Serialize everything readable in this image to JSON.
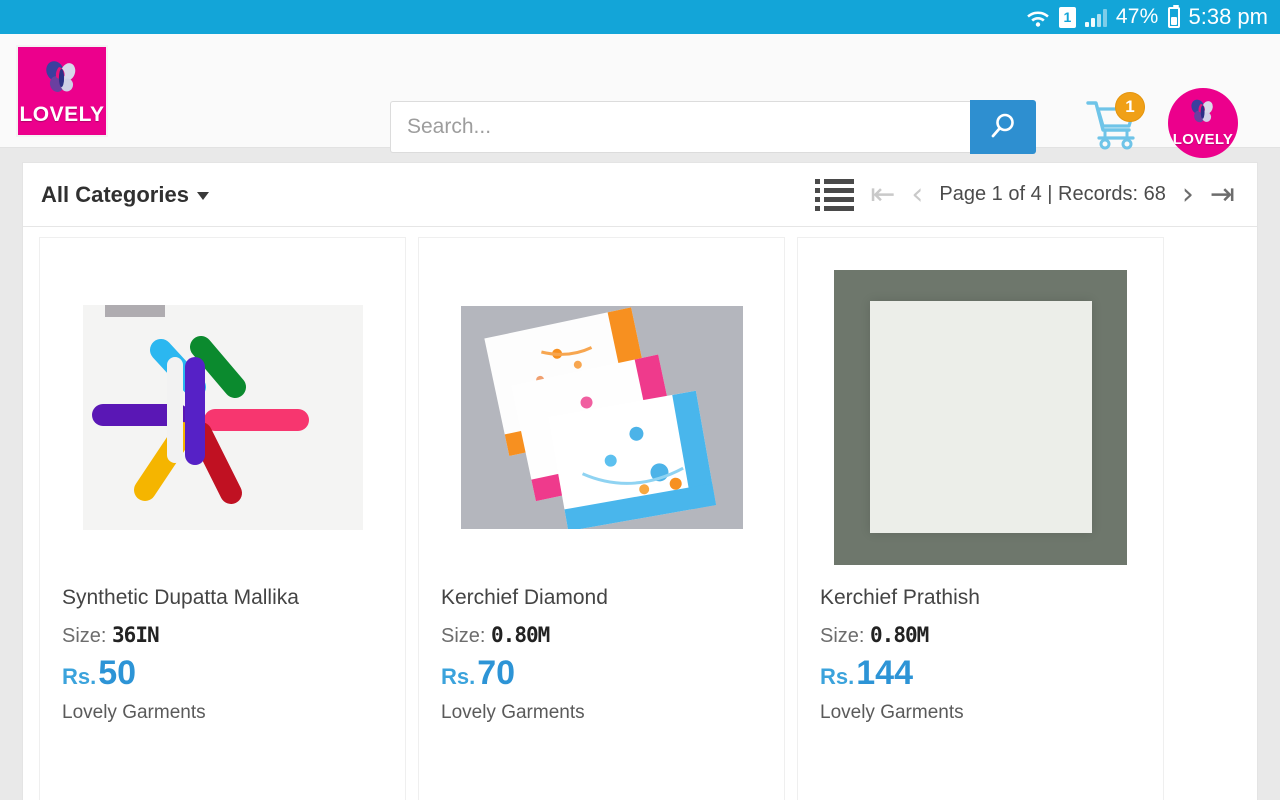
{
  "statusbar": {
    "wifi_icon": "wifi-icon",
    "sim_label": "1",
    "signal_icon": "signal-bars-icon",
    "battery_percent": "47%",
    "battery_icon": "battery-icon",
    "time": "5:38 pm"
  },
  "header": {
    "logo_text": "LOVELY",
    "logo_icon": "butterfly-icon",
    "search": {
      "placeholder": "Search...",
      "value": "",
      "button_icon": "search-icon"
    },
    "cart": {
      "icon": "shopping-cart-icon",
      "badge_count": "1"
    },
    "avatar": {
      "icon": "user-avatar-icon",
      "label": "LOVELY"
    }
  },
  "toolbar": {
    "categories_label": "All Categories",
    "categories_caret": "chevron-down-icon",
    "view_toggle_icon": "list-view-icon",
    "first_page_icon": "first-page-icon",
    "prev_page_icon": "prev-page-icon",
    "pager_text": "Page 1 of 4 | Records: 68",
    "next_page_icon": "next-page-icon",
    "last_page_icon": "last-page-icon",
    "page_current": 1,
    "page_total": 4,
    "records": 68
  },
  "products": [
    {
      "name": "Synthetic Dupatta Mallika",
      "size_label": "Size:",
      "size_value": "36IN",
      "currency": "Rs.",
      "price": "50",
      "brand": "Lovely Garments",
      "image_alt": "colorful-rolled-dupattas"
    },
    {
      "name": "Kerchief Diamond",
      "size_label": "Size:",
      "size_value": "0.80M",
      "currency": "Rs.",
      "price": "70",
      "brand": "Lovely Garments",
      "image_alt": "floral-handkerchiefs-trio"
    },
    {
      "name": "Kerchief Prathish",
      "size_label": "Size:",
      "size_value": "0.80M",
      "currency": "Rs.",
      "price": "144",
      "brand": "Lovely Garments",
      "image_alt": "white-folded-handkerchief"
    }
  ],
  "colors": {
    "status_bar": "#13A5D8",
    "brand_pink": "#EC008C",
    "accent_blue": "#2D94D6",
    "search_button": "#2E8FD0",
    "cart_badge": "#F0A017",
    "page_bg": "#e9e9e9"
  }
}
